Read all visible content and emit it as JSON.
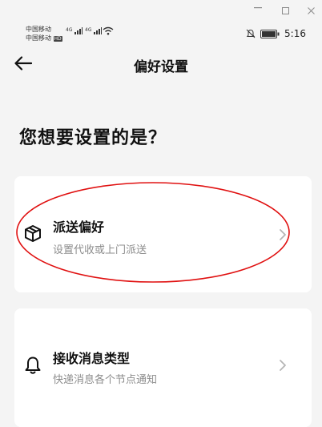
{
  "status_bar": {
    "carrier_1": "中国移动",
    "carrier_2": "中国移动",
    "signal_1": "4G",
    "signal_2": "4G",
    "hd_badge": "HD",
    "time": "5:16"
  },
  "nav": {
    "title": "偏好设置"
  },
  "question": "您想要设置的是？",
  "options": [
    {
      "title": "派送偏好",
      "description": "设置代收或上门派送",
      "icon": "package-icon"
    },
    {
      "title": "接收消息类型",
      "description": "快递消息各个节点通知",
      "icon": "bell-icon"
    }
  ],
  "colors": {
    "background": "#f4f4f4",
    "card": "#ffffff",
    "annotation_red": "#e01010",
    "secondary_text": "#8c8c8c"
  }
}
